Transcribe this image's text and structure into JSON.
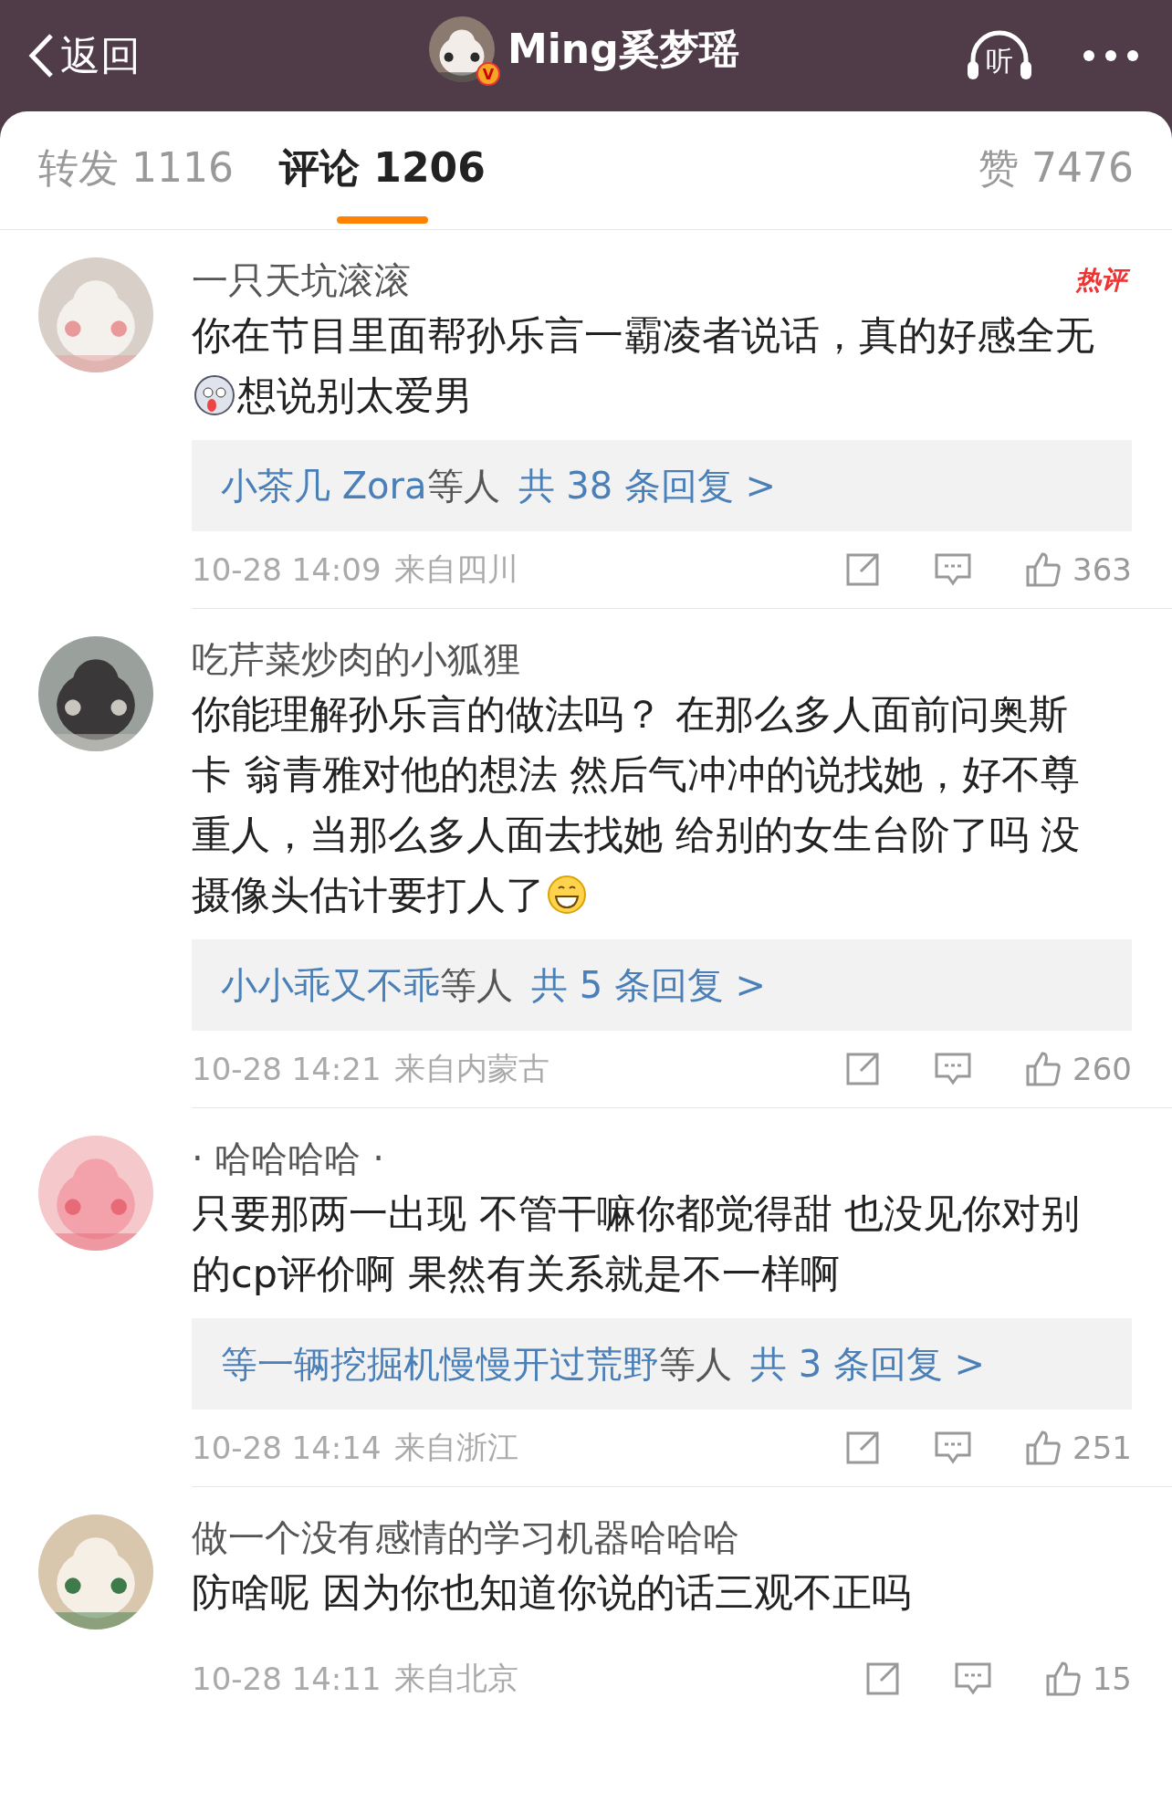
{
  "header": {
    "back_label": "返回",
    "title": "Ming奚梦瑶",
    "verified_mark": "V",
    "listen_label": "听"
  },
  "tabs": [
    {
      "label": "转发 1116",
      "selected": false
    },
    {
      "label": "评论 1206",
      "selected": true
    },
    {
      "label": "赞 7476",
      "selected": false
    }
  ],
  "comments": [
    {
      "username": "一只天坑滚滚",
      "badge": "热评",
      "body": [
        [
          {
            "kind": "text",
            "text": "你在节目里面帮孙乐言一霸凌者说话，真的好感全无"
          }
        ],
        [
          {
            "kind": "emoji"
          },
          {
            "kind": "text",
            "text": "想说别太爱男"
          }
        ]
      ],
      "replies": {
        "names": "小茶几 Zora",
        "suffix": "等人",
        "count": "共 38 条回复 >"
      },
      "time": "10-28 14:09",
      "location": "来自四川",
      "likes": "363"
    },
    {
      "username": "吃芹菜炒肉的小狐狸",
      "body": [
        [
          {
            "kind": "text",
            "text": "你能理解孙乐言的做法吗？ 在那么多人面前问奥斯"
          }
        ],
        [
          {
            "kind": "text",
            "text": "卡 翁青雅对他的想法 然后气冲冲的说找她，好不尊"
          }
        ],
        [
          {
            "kind": "text",
            "text": "重人，当那么多人面去找她 给别的女生台阶了吗 没"
          }
        ],
        [
          {
            "kind": "text",
            "text": "摄像头估计要打人了"
          },
          {
            "kind": "grin"
          }
        ]
      ],
      "replies": {
        "names": "小小乖又不乖",
        "suffix": "等人",
        "count": "共 5 条回复 >"
      },
      "time": "10-28 14:21",
      "location": "来自内蒙古",
      "likes": "260"
    },
    {
      "username": "· 哈哈哈哈 ·",
      "body": [
        [
          {
            "kind": "text",
            "text": "只要那两一出现 不管干嘛你都觉得甜 也没见你对别"
          }
        ],
        [
          {
            "kind": "text",
            "text": "的cp评价啊 果然有关系就是不一样啊"
          }
        ]
      ],
      "replies": {
        "names": "等一辆挖掘机慢慢开过荒野",
        "suffix": "等人",
        "count": "共 3 条回复 >"
      },
      "time": "10-28 14:14",
      "location": "来自浙江",
      "likes": "251"
    },
    {
      "username": "做一个没有感情的学习机器哈哈哈",
      "body": [
        [
          {
            "kind": "text",
            "text": "防啥呢 因为你也知道你说的话三观不正吗"
          }
        ]
      ],
      "time": "10-28 14:11",
      "location": "来自北京",
      "likes": "15"
    }
  ]
}
